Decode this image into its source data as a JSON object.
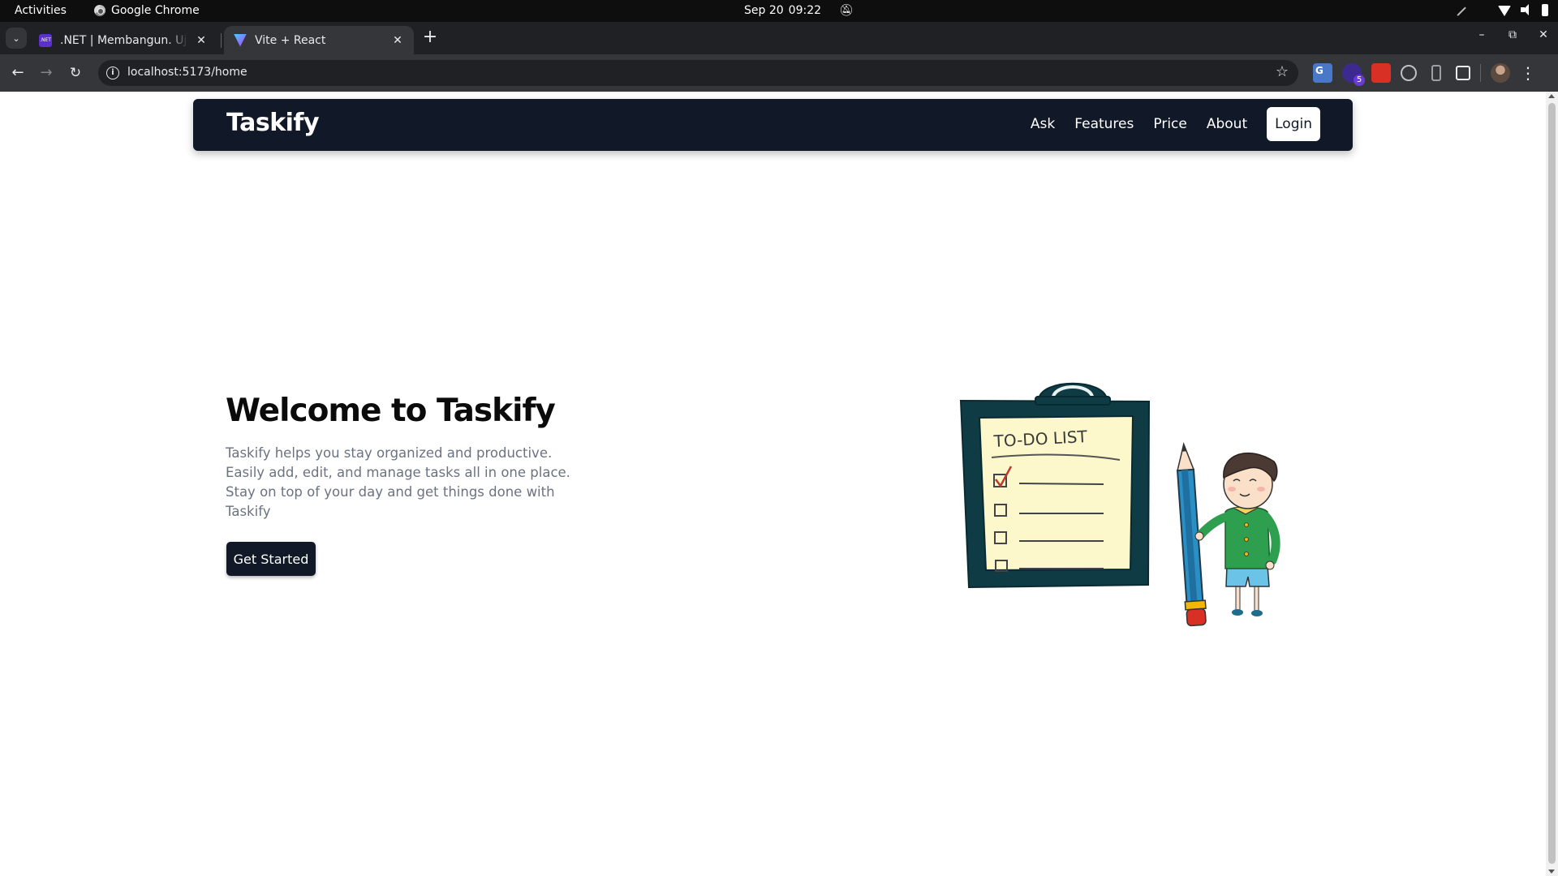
{
  "system_bar": {
    "activities": "Activities",
    "app_name": "Google Chrome",
    "date": "Sep 20",
    "time": "09:22"
  },
  "browser": {
    "tabs": [
      {
        "title": ".NET | Membangun. Uji. S",
        "favicon": "dotnet-icon",
        "active": false
      },
      {
        "title": "Vite + React",
        "favicon": "vite-icon",
        "active": true
      }
    ],
    "url": "localhost:5173/home",
    "extension_badge": "5"
  },
  "navbar": {
    "brand": "Taskify",
    "links": [
      "Ask",
      "Features",
      "Price",
      "About"
    ],
    "login": "Login"
  },
  "hero": {
    "title": "Welcome to Taskify",
    "description_lines": [
      "Taskify helps you stay organized and productive.",
      "Easily add, edit, and manage tasks all in one place.",
      "Stay on top of your day and get things done with",
      "Taskify"
    ],
    "cta": "Get Started"
  },
  "illustration": {
    "clipboard_title": "TO-DO LIST",
    "checked_items": 1,
    "total_items": 4,
    "colors": {
      "board": "#0f3b45",
      "paper": "#fcf8cc",
      "pencil": "#2a8fc4",
      "shirt": "#2e9e4f",
      "shorts": "#6cc3e8",
      "hair": "#4a3a33",
      "skin": "#fbe0c9",
      "check": "#c0392b"
    }
  },
  "colors": {
    "navbar_bg": "#111827",
    "text_muted": "#6b7280",
    "button_bg": "#111827"
  }
}
